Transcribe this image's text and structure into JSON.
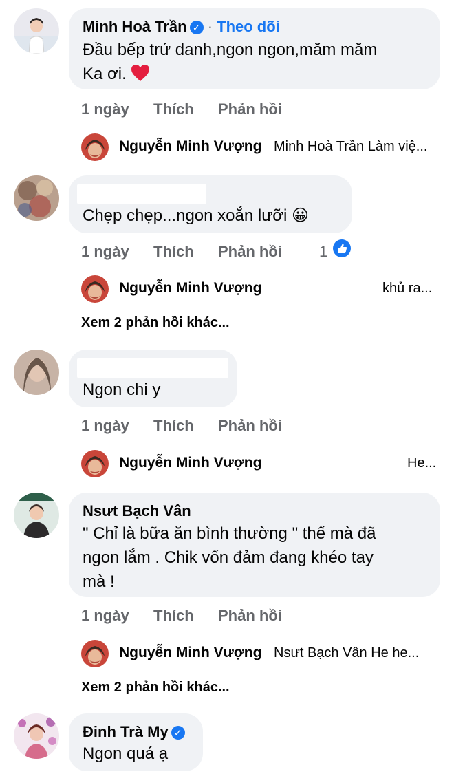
{
  "comments": [
    {
      "name": "Minh Hoà Trần",
      "follow_sep": "·",
      "follow_label": "Theo dõi",
      "text_line1": "Đầu bếp trứ danh,ngon ngon,măm măm",
      "text_line2": "Ka ơi.",
      "time": "1 ngày",
      "like": "Thích",
      "reply": "Phản hồi",
      "reply_preview": {
        "name": "Nguyễn Minh Vượng",
        "text": "Minh Hoà Trần Làm việ..."
      }
    },
    {
      "text_line1": "Chẹp chẹp...ngon xoắn lưỡi",
      "emoji": "😀",
      "time": "1 ngày",
      "like": "Thích",
      "reply": "Phản hồi",
      "like_count": "1",
      "reply_preview": {
        "name": "Nguyễn Minh Vượng",
        "text": "khủ ra..."
      },
      "more": "Xem 2 phản hồi khác..."
    },
    {
      "text_line1": "Ngon chi y",
      "time": "1 ngày",
      "like": "Thích",
      "reply": "Phản hồi",
      "reply_preview": {
        "name": "Nguyễn Minh Vượng",
        "text": "He..."
      }
    },
    {
      "name": "Nsưt Bạch Vân",
      "text_line1": "\" Chỉ là bữa ăn bình thường \" thế mà đã",
      "text_line2": "ngon lắm . Chik vốn đảm đang khéo tay",
      "text_line3": "mà !",
      "time": "1 ngày",
      "like": "Thích",
      "reply": "Phản hồi",
      "reply_preview": {
        "name": "Nguyễn Minh Vượng",
        "text": "Nsưt Bạch Vân He he..."
      },
      "more": "Xem 2 phản hồi khác..."
    },
    {
      "name": "Đinh Trà My",
      "text_line1": "Ngon quá ạ"
    }
  ],
  "icons": {
    "verified": "✓",
    "heart": "heart-icon",
    "like": "like-thumb-icon"
  },
  "colors": {
    "accent": "#1877f2",
    "heart": "#e41e3f",
    "muted": "#65676b",
    "bubble": "#f0f2f5"
  }
}
